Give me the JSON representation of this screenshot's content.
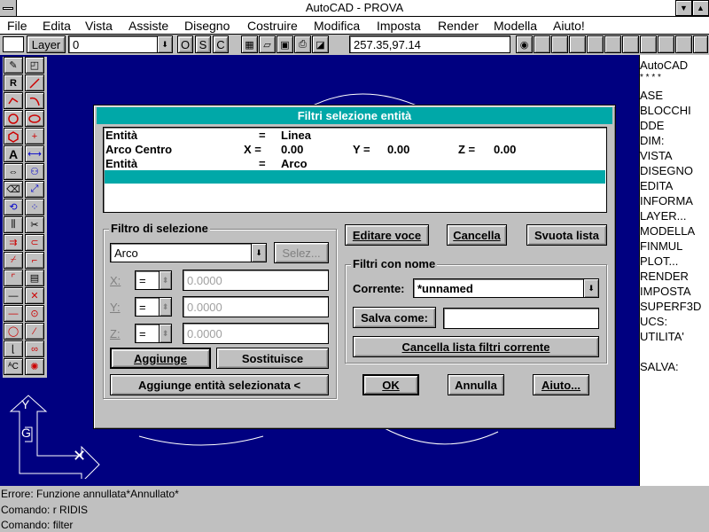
{
  "window": {
    "title": "AutoCAD - PROVA"
  },
  "menu": [
    "File",
    "Edita",
    "Vista",
    "Assiste",
    "Disegno",
    "Costruire",
    "Modifica",
    "Imposta",
    "Render",
    "Modella",
    "Aiuto!"
  ],
  "toolbar": {
    "layer_label": "Layer",
    "layer_value": "0",
    "mode_o": "O",
    "mode_s": "S",
    "mode_c": "C",
    "coords": "257.35,97.14"
  },
  "side_menu": [
    "AutoCAD",
    "* * * *",
    "ASE",
    "BLOCCHI",
    "DDE",
    "DIM:",
    "VISTA",
    "DISEGNO",
    "EDITA",
    "INFORMA",
    "LAYER...",
    "MODELLA",
    "FINMUL",
    "PLOT...",
    "RENDER",
    "IMPOSTA",
    "SUPERF3D",
    "UCS:",
    "UTILITA'",
    "",
    "SALVA:"
  ],
  "ucs_icon": {
    "y": "Y",
    "g": "G"
  },
  "status": [
    "Errore: Funzione annullata*Annullato*",
    "Comando: r RIDIS",
    "Comando: filter"
  ],
  "dialog": {
    "title": "Filtri selezione entità",
    "list": [
      {
        "c1": "Entità",
        "c2": "=",
        "c3": "Linea",
        "c4": "",
        "c5": "",
        "c6": "",
        "c7": ""
      },
      {
        "c1": "Arco Centro",
        "c2": "X =",
        "c3": "0.00",
        "c4": "Y =",
        "c5": "0.00",
        "c6": "Z =",
        "c7": "0.00"
      },
      {
        "c1": "Entità",
        "c2": "=",
        "c3": "Arco",
        "c4": "",
        "c5": "",
        "c6": "",
        "c7": ""
      }
    ],
    "filter_group": "Filtro di selezione",
    "filter_type": "Arco",
    "select_btn": "Selez...",
    "x_label": "X:",
    "y_label": "Y:",
    "z_label": "Z:",
    "op": "=",
    "x_value": "0.0000",
    "y_value": "0.0000",
    "z_value": "0.0000",
    "add_btn": "Aggiunge",
    "replace_btn": "Sostituisce",
    "add_selected_btn": "Aggiunge entità selezionata <",
    "edit_btn": "Editare voce",
    "delete_btn": "Cancella",
    "clear_btn": "Svuota lista",
    "named_group": "Filtri con nome",
    "current_label": "Corrente:",
    "current_value": "*unnamed",
    "saveas_btn": "Salva come:",
    "saveas_value": "",
    "delete_current_btn": "Cancella lista filtri corrente",
    "ok_btn": "OK",
    "cancel_btn": "Annulla",
    "help_btn": "Aiuto..."
  }
}
